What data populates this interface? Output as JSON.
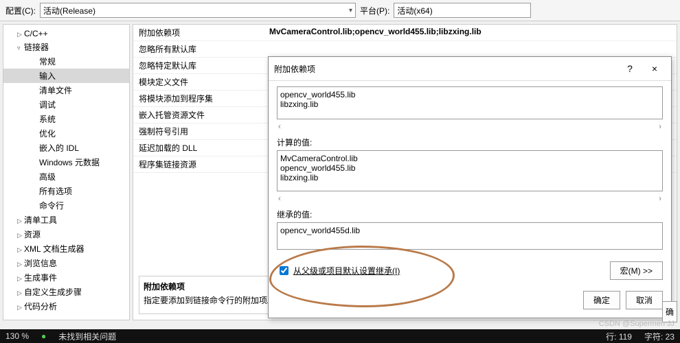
{
  "topbar": {
    "config_label": "配置(C):",
    "config_value": "活动(Release)",
    "platform_label": "平台(P):",
    "platform_value": "活动(x64)"
  },
  "tree": {
    "items": [
      {
        "label": "C/C++",
        "level": 0,
        "arrow": "▷"
      },
      {
        "label": "链接器",
        "level": 0,
        "arrow": "▿"
      },
      {
        "label": "常规",
        "level": 2
      },
      {
        "label": "输入",
        "level": 2,
        "selected": true
      },
      {
        "label": "清单文件",
        "level": 2
      },
      {
        "label": "调试",
        "level": 2
      },
      {
        "label": "系统",
        "level": 2
      },
      {
        "label": "优化",
        "level": 2
      },
      {
        "label": "嵌入的 IDL",
        "level": 2
      },
      {
        "label": "Windows 元数据",
        "level": 2
      },
      {
        "label": "高级",
        "level": 2
      },
      {
        "label": "所有选项",
        "level": 2
      },
      {
        "label": "命令行",
        "level": 2
      },
      {
        "label": "清单工具",
        "level": 0,
        "arrow": "▷"
      },
      {
        "label": "资源",
        "level": 0,
        "arrow": "▷"
      },
      {
        "label": "XML 文档生成器",
        "level": 0,
        "arrow": "▷"
      },
      {
        "label": "浏览信息",
        "level": 0,
        "arrow": "▷"
      },
      {
        "label": "生成事件",
        "level": 0,
        "arrow": "▷"
      },
      {
        "label": "自定义生成步骤",
        "level": 0,
        "arrow": "▷"
      },
      {
        "label": "代码分析",
        "level": 0,
        "arrow": "▷"
      }
    ]
  },
  "props": {
    "rows": [
      {
        "label": "附加依赖项",
        "value": "MvCameraControl.lib;opencv_world455.lib;libzxing.lib"
      },
      {
        "label": "忽略所有默认库",
        "value": ""
      },
      {
        "label": "忽略特定默认库",
        "value": ""
      },
      {
        "label": "模块定义文件",
        "value": ""
      },
      {
        "label": "将模块添加到程序集",
        "value": ""
      },
      {
        "label": "嵌入托管资源文件",
        "value": ""
      },
      {
        "label": "强制符号引用",
        "value": ""
      },
      {
        "label": "延迟加载的 DLL",
        "value": ""
      },
      {
        "label": "程序集链接资源",
        "value": ""
      }
    ],
    "desc_title": "附加依赖项",
    "desc_text": "指定要添加到链接命令行的附加项。[例如"
  },
  "dialog": {
    "title": "附加依赖项",
    "help": "?",
    "close": "×",
    "ta1": "opencv_world455.lib\nlibzxing.lib",
    "computed_label": "计算的值:",
    "ta2": "MvCameraControl.lib\nopencv_world455.lib\nlibzxing.lib",
    "inherited_label": "继承的值:",
    "ta3": "opencv_world455d.lib",
    "inherit_check": "从父级或项目默认设置继承(I)",
    "macro_btn": "宏(M) >>",
    "ok": "确定",
    "cancel": "取消"
  },
  "status": {
    "zoom": "130 %",
    "issues": "未找到相关问题",
    "line": "行: 119",
    "col": "字符: 23"
  },
  "watermark": "CSDN @Supermen JJ",
  "side_ok": "确"
}
